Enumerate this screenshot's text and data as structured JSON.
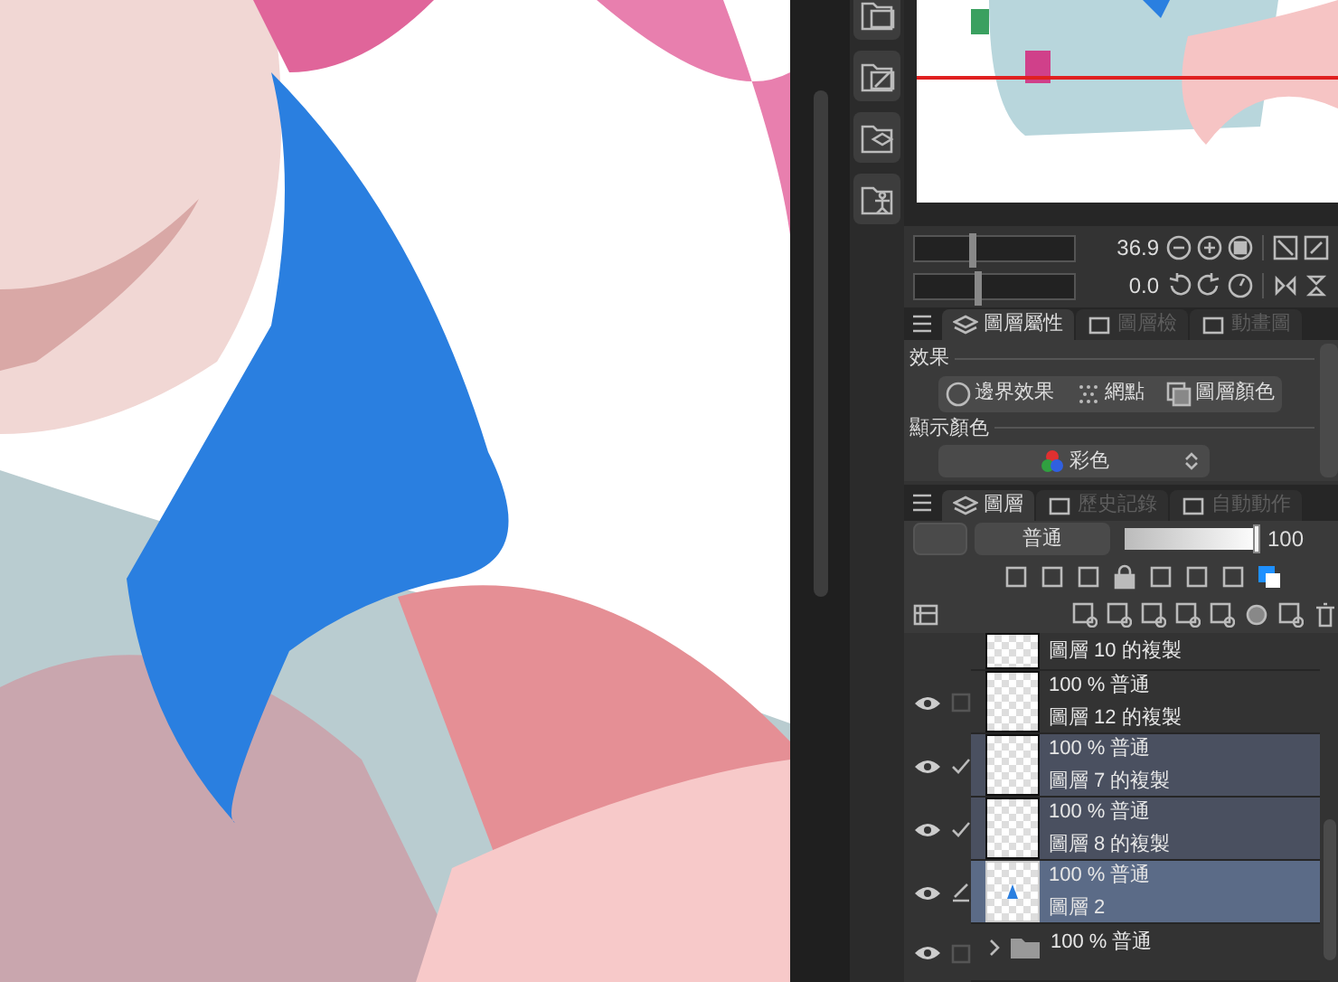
{
  "zoom": {
    "reading": "36.9",
    "level": 0.35
  },
  "rotation": {
    "reading": "0.0",
    "level": 0.38
  },
  "property_tabs": [
    {
      "label": "圖層屬性",
      "selected": true
    },
    {
      "label": "圖層檢",
      "selected": false
    },
    {
      "label": "動畫圖",
      "selected": false
    }
  ],
  "effect": {
    "heading": "效果",
    "buttons": [
      "邊界效果",
      "網點",
      "圖層顏色"
    ]
  },
  "display_color": {
    "heading": "顯示顏色",
    "value": "彩色"
  },
  "layer_tabs": [
    {
      "label": "圖層",
      "selected": true
    },
    {
      "label": "歷史記錄",
      "selected": false
    },
    {
      "label": "自動動作",
      "selected": false
    }
  ],
  "blend": {
    "mode": "普通",
    "opacity": "100",
    "level": 1.0
  },
  "layers": [
    {
      "name": "圖層 10 的複製",
      "selected": false,
      "current": false,
      "kind": "partial"
    },
    {
      "name": "圖層 12 的複製",
      "info": "100 % 普通",
      "checked": false,
      "editing": false,
      "selected": false,
      "current": false,
      "visible": true,
      "kind": "layer"
    },
    {
      "name": "圖層 7 的複製",
      "info": "100 % 普通",
      "checked": true,
      "editing": false,
      "selected": true,
      "current": false,
      "visible": true,
      "kind": "layer"
    },
    {
      "name": "圖層 8 的複製",
      "info": "100 % 普通",
      "checked": true,
      "editing": false,
      "selected": true,
      "current": false,
      "visible": true,
      "kind": "layer"
    },
    {
      "name": "圖層 2",
      "info": "100 % 普通",
      "editing": true,
      "selected": true,
      "current": true,
      "visible": true,
      "kind": "layer"
    },
    {
      "info": "100 % 普通",
      "checked": false,
      "editing": false,
      "selected": false,
      "visible": true,
      "kind": "folder"
    }
  ]
}
